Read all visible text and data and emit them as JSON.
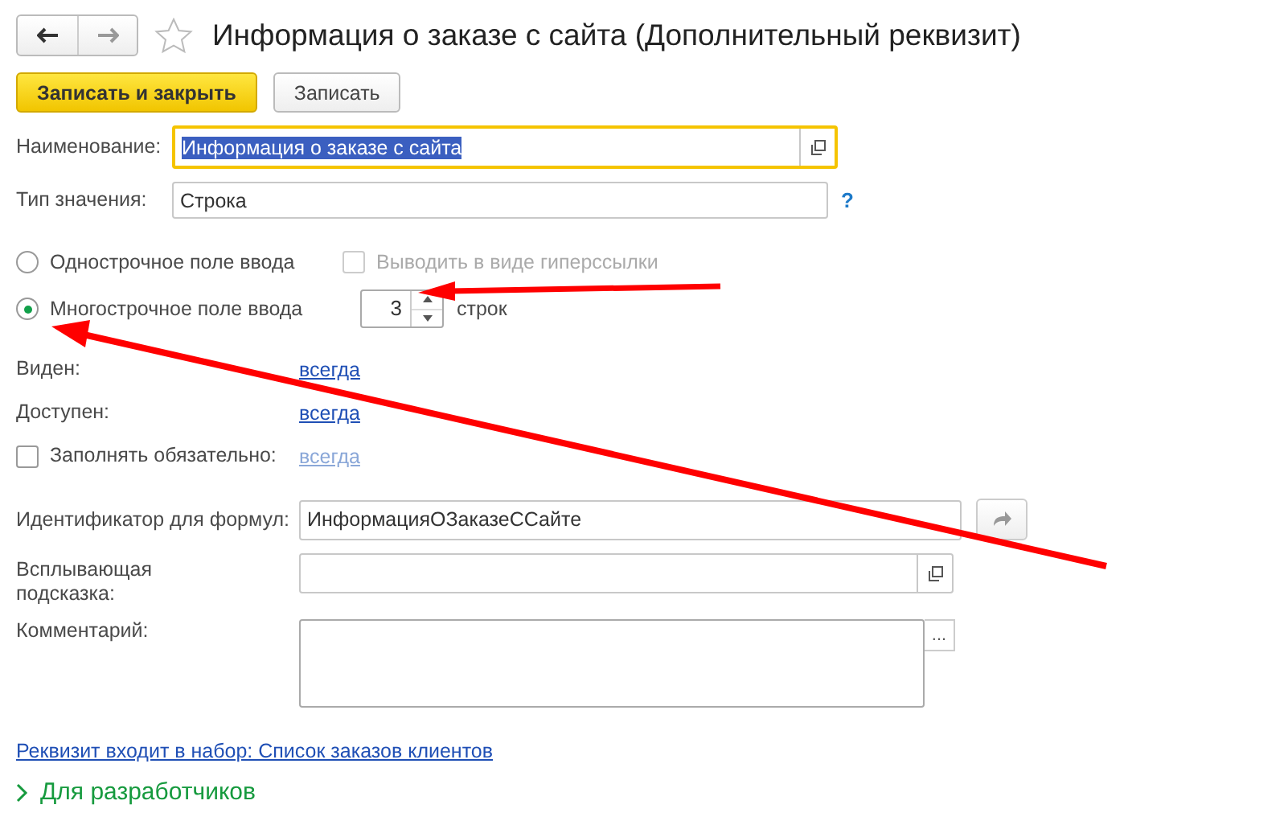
{
  "title": "Информация о заказе с сайта (Дополнительный реквизит)",
  "favorite": false,
  "buttons": [
    {
      "label": "Записать и закрыть",
      "kind": "primary"
    },
    {
      "label": "Записать",
      "kind": "secondary"
    }
  ],
  "name_field": {
    "label": "Наименование:",
    "value": "Информация о заказе с сайта",
    "focused": true,
    "highlighted": true
  },
  "value_type": {
    "label": "Тип значения:",
    "value": "Строка",
    "help": "?"
  },
  "input_modes": [
    {
      "label": "Однострочное поле ввода",
      "selected": false
    },
    {
      "label": "Многострочное поле ввода",
      "selected": true
    }
  ],
  "hyperlink_option": {
    "label": "Выводить в виде гиперссылки",
    "checked": false,
    "disabled": true
  },
  "lines": {
    "value": "3",
    "suffix": "строк"
  },
  "availability": [
    {
      "label": "Виден:",
      "value": "всегда",
      "kind": "plain"
    },
    {
      "label": "Доступен:",
      "value": "всегда",
      "kind": "plain"
    },
    {
      "label": "Заполнять обязательно:",
      "value": "всегда",
      "kind": "checkbox",
      "checked": false,
      "dimmed": true
    }
  ],
  "identifier": {
    "label": "Идентификатор для формул:",
    "value": "ИнформацияОЗаказеССайте"
  },
  "tooltip": {
    "label": "Всплывающая подсказка:"
  },
  "comment": {
    "label": "Комментарий:",
    "button": "..."
  },
  "set_link": "Реквизит входит в набор: Список заказов клиентов",
  "developers": {
    "label": "Для разработчиков",
    "expanded": false
  }
}
